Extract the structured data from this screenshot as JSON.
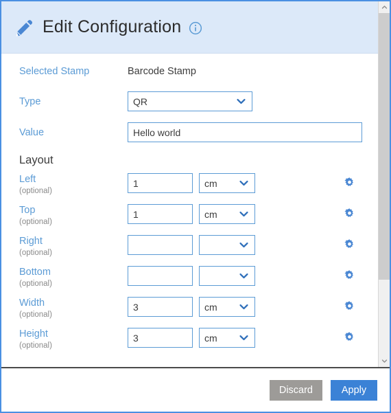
{
  "header": {
    "title": "Edit Configuration",
    "pencil_icon": "pencil-icon",
    "info_icon": "info-icon",
    "background_color": "#dce9f9",
    "accent_color": "#4a90e2"
  },
  "form": {
    "selected_stamp": {
      "label": "Selected Stamp",
      "value": "Barcode Stamp"
    },
    "type": {
      "label": "Type",
      "value": "QR"
    },
    "value_field": {
      "label": "Value",
      "value": "Hello world",
      "placeholder": ""
    }
  },
  "layout": {
    "heading": "Layout",
    "optional_note": "(optional)",
    "rows": [
      {
        "label": "Left",
        "note": "(optional)",
        "amount": "1",
        "unit": "cm",
        "gear": "gear-icon"
      },
      {
        "label": "Top",
        "note": "(optional)",
        "amount": "1",
        "unit": "cm",
        "gear": "gear-icon"
      },
      {
        "label": "Right",
        "note": "(optional)",
        "amount": "",
        "unit": "",
        "gear": "gear-icon"
      },
      {
        "label": "Bottom",
        "note": "(optional)",
        "amount": "",
        "unit": "",
        "gear": "gear-icon"
      },
      {
        "label": "Width",
        "note": "(optional)",
        "amount": "3",
        "unit": "cm",
        "gear": "gear-icon"
      },
      {
        "label": "Height",
        "note": "(optional)",
        "amount": "3",
        "unit": "cm",
        "gear": "gear-icon"
      }
    ]
  },
  "footer": {
    "discard_label": "Discard",
    "apply_label": "Apply",
    "discard_color": "#9d9b98",
    "apply_color": "#3b82d6"
  },
  "scrollbar": {
    "up_icon": "chevron-up-icon",
    "down_icon": "chevron-down-icon"
  }
}
